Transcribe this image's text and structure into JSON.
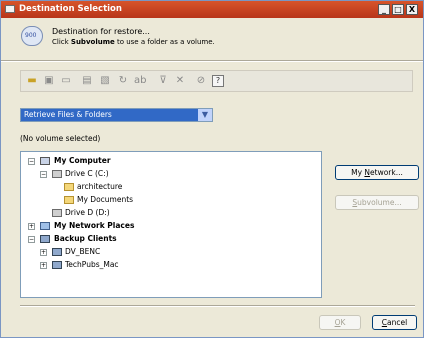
{
  "window": {
    "title": "Destination Selection"
  },
  "titlebar_buttons": {
    "minimize": "_",
    "maximize": "□",
    "close": "X"
  },
  "header": {
    "title": "Destination for restore...",
    "subtitle_prefix": "Click ",
    "subtitle_bold": "Subvolume",
    "subtitle_suffix": " to use a folder as a volume."
  },
  "toolbar": {
    "tools": [
      "folder-open-icon",
      "refresh-icon",
      "map-icon",
      "properties-icon",
      "rename-icon",
      "link-icon",
      "text-icon",
      "filter-icon",
      "delete-icon",
      "unlink-icon",
      "help-icon"
    ]
  },
  "select": {
    "value": "Retrieve Files & Folders"
  },
  "status": {
    "volume": "(No volume selected)"
  },
  "tree": {
    "my_computer": "My Computer",
    "drive_c": "Drive C (C:)",
    "architecture": "architecture",
    "my_documents": "My Documents",
    "drive_d": "Drive D (D:)",
    "network_places": "My Network Places",
    "backup_clients": "Backup Clients",
    "client1": "DV_BENC",
    "client2": "TechPubs_Mac"
  },
  "buttons": {
    "network_pre": "My ",
    "network_u": "N",
    "network_post": "etwork...",
    "subvolume_u": "S",
    "subvolume_post": "ubvolume...",
    "ok_u": "O",
    "ok_post": "K",
    "cancel_u": "C",
    "cancel_post": "ancel"
  },
  "colors": {
    "titlebar": "#c0411e",
    "selection": "#3169c6",
    "window_bg": "#ece9d8"
  }
}
